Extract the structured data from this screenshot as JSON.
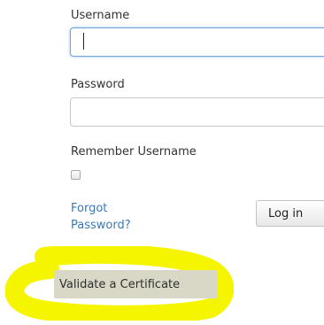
{
  "form": {
    "username_label": "Username",
    "username_value": "",
    "password_label": "Password",
    "password_value": "",
    "remember_label": "Remember Username",
    "remember_checked": false,
    "forgot_link": "Forgot Password?",
    "login_button": "Log in"
  },
  "certificate": {
    "validate_button": "Validate a Certificate"
  },
  "colors": {
    "link": "#3a78b6",
    "focus_border": "#6fa3dc",
    "highlight": "#f5f500"
  },
  "icons": {
    "highlight_mark": "yellow-highlight-scribble"
  }
}
